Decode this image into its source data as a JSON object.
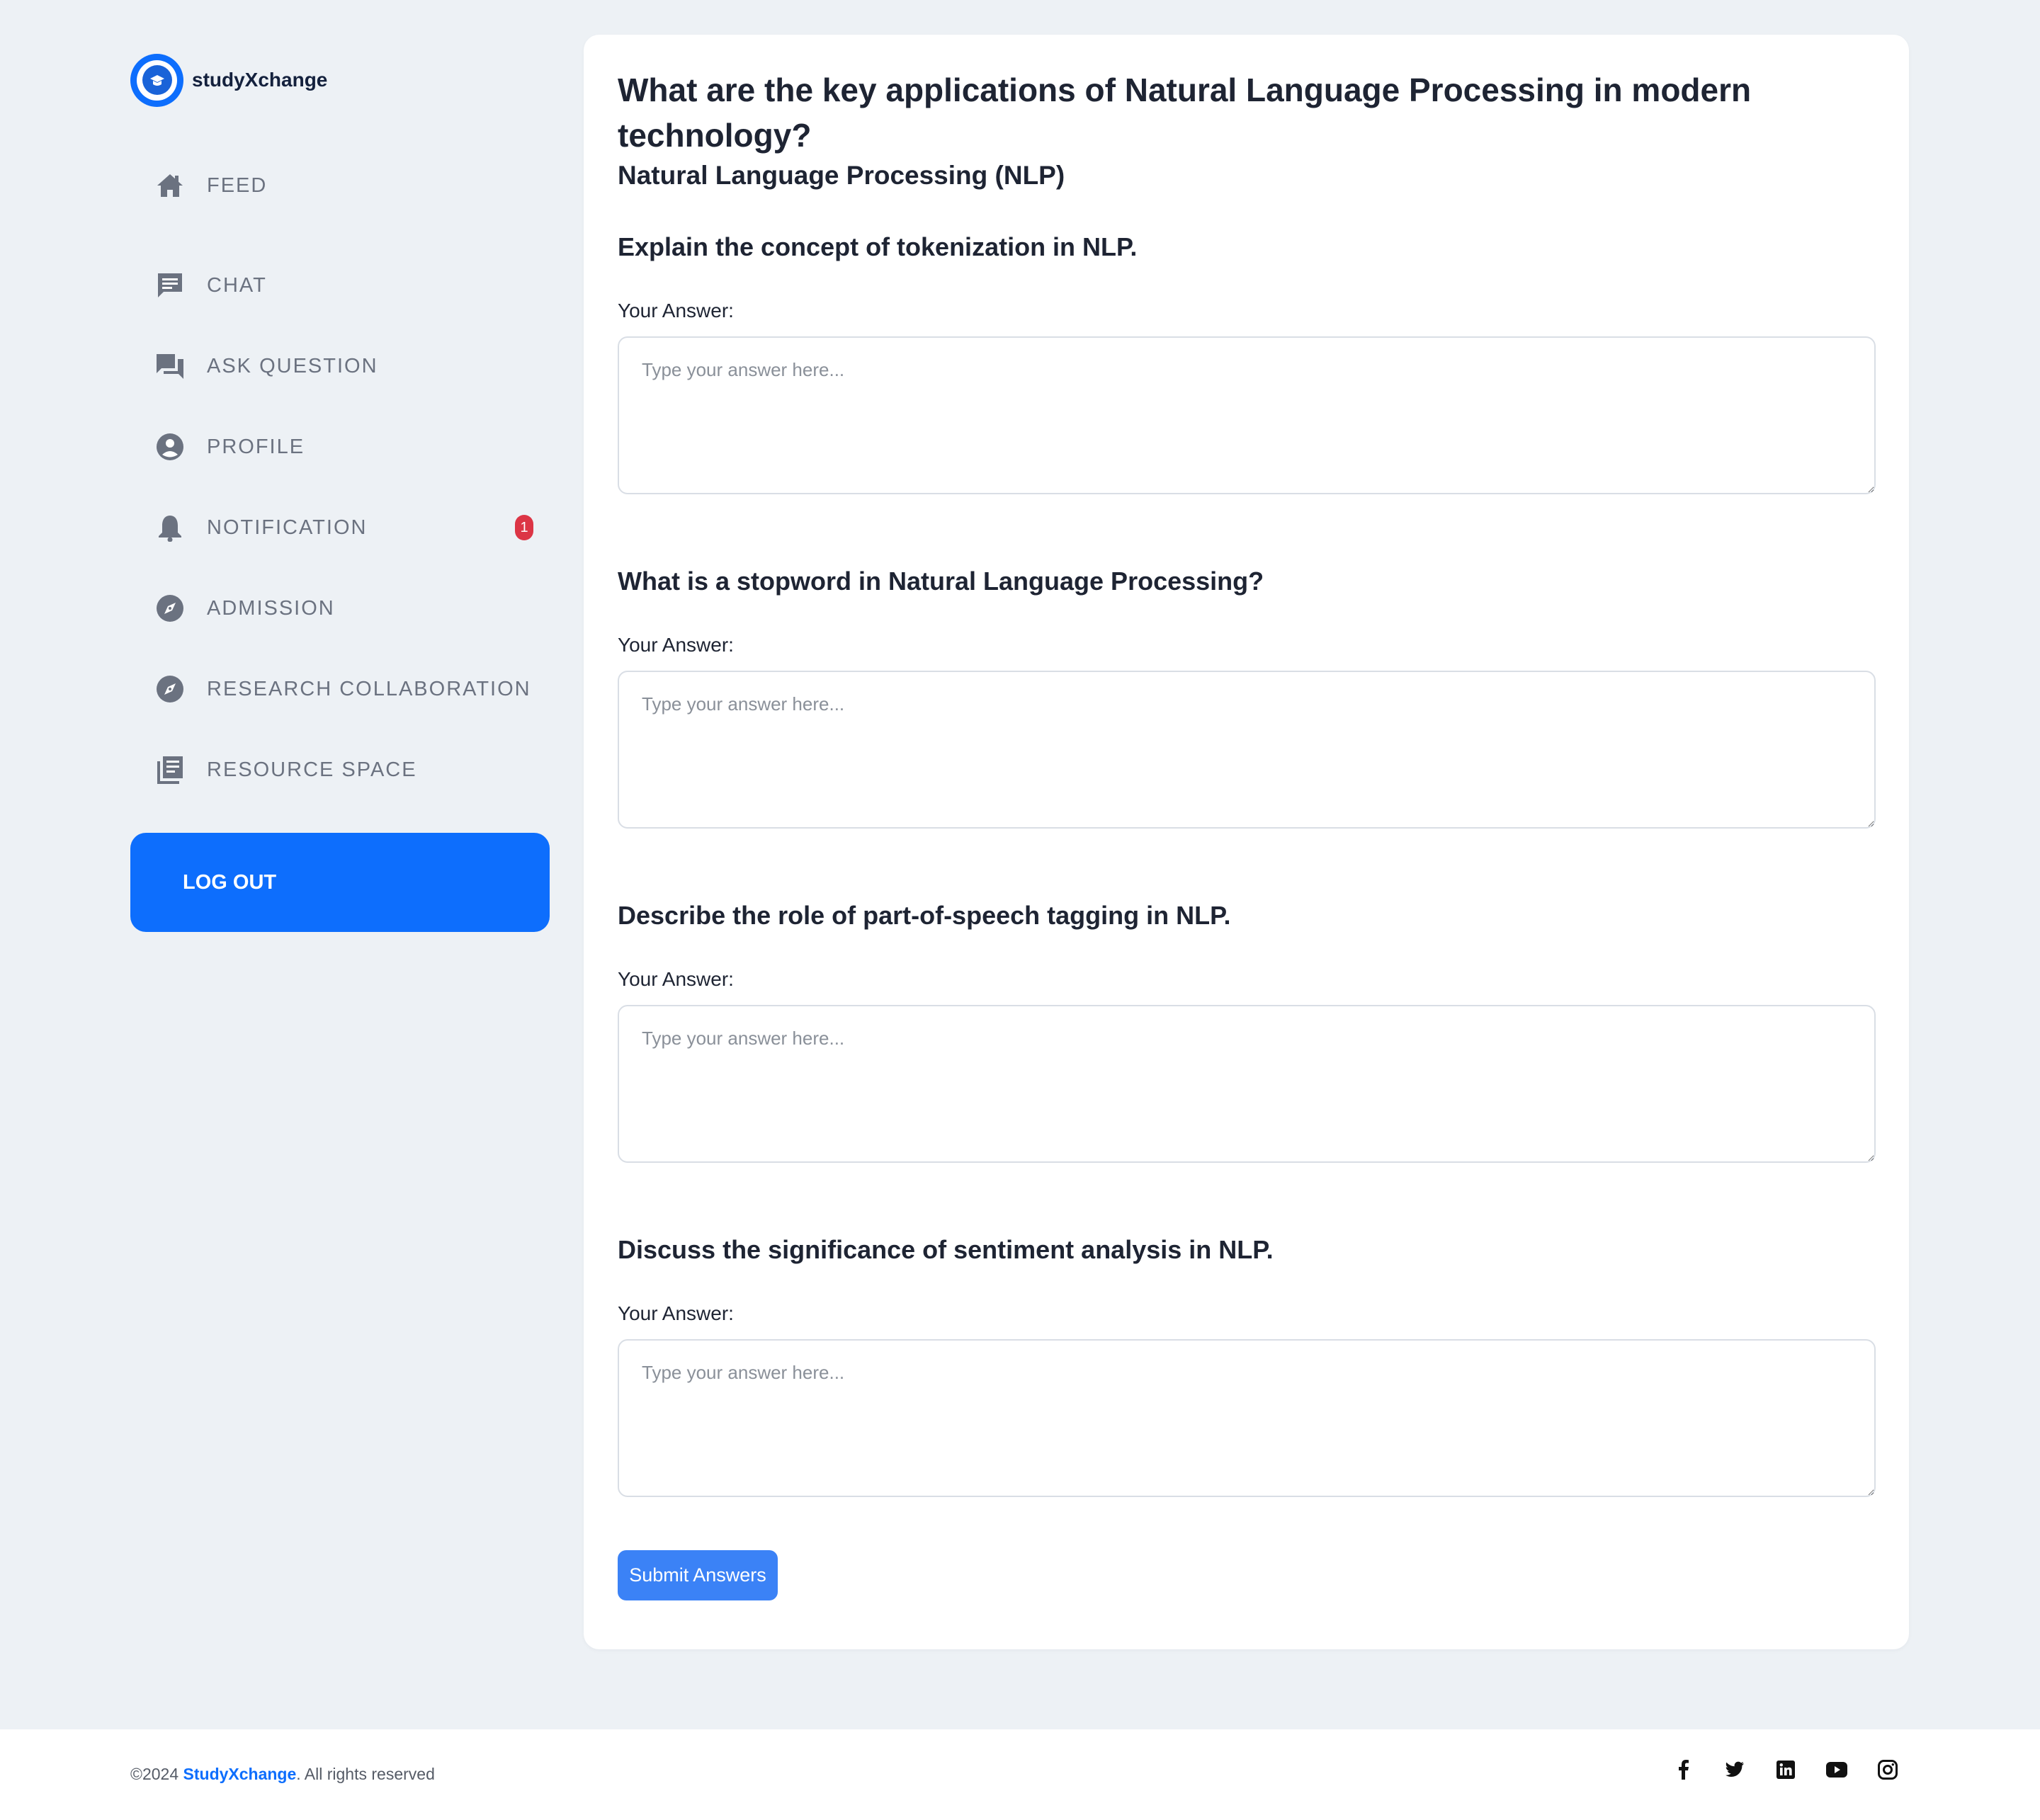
{
  "brand": {
    "name": "studyXchange"
  },
  "sidebar": {
    "items": [
      {
        "label": "FEED",
        "icon": "home-icon"
      },
      {
        "label": "CHAT",
        "icon": "chat-icon"
      },
      {
        "label": "ASK QUESTION",
        "icon": "forum-icon"
      },
      {
        "label": "PROFILE",
        "icon": "user-circle-icon"
      },
      {
        "label": "NOTIFICATION",
        "icon": "bell-icon",
        "badge": "1"
      },
      {
        "label": "ADMISSION",
        "icon": "compass-icon"
      },
      {
        "label": "RESEARCH COLLABORATION",
        "icon": "compass-icon"
      },
      {
        "label": "RESOURCE SPACE",
        "icon": "library-icon"
      }
    ],
    "logout_label": "LOG OUT"
  },
  "main": {
    "title": "What are the key applications of Natural Language Processing in modern technology?",
    "topic": "Natural Language Processing (NLP)",
    "answer_label": "Your Answer:",
    "answer_placeholder": "Type your answer here...",
    "questions": [
      {
        "text": "Explain the concept of tokenization in NLP."
      },
      {
        "text": "What is a stopword in Natural Language Processing?"
      },
      {
        "text": "Describe the role of part-of-speech tagging in NLP."
      },
      {
        "text": "Discuss the significance of sentiment analysis in NLP."
      }
    ],
    "submit_label": "Submit Answers"
  },
  "footer": {
    "copyright_prefix": "©2024 ",
    "brand": "StudyXchange",
    "copyright_suffix": ". All rights reserved",
    "socials": [
      "facebook-icon",
      "twitter-icon",
      "linkedin-icon",
      "youtube-icon",
      "instagram-icon"
    ]
  },
  "colors": {
    "accent": "#0d6efd",
    "submit": "#3b82f6",
    "badge": "#dc3545",
    "background": "#edf1f5"
  }
}
